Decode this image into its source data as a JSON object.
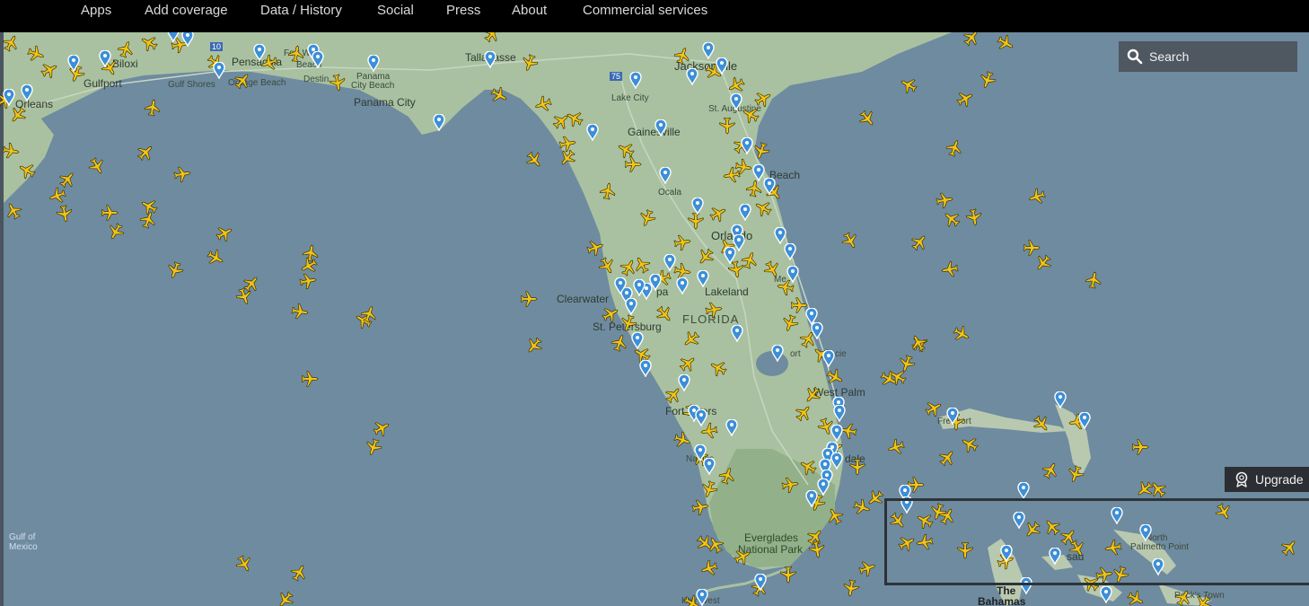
{
  "nav": {
    "items": [
      "Apps",
      "Add coverage",
      "Data / History",
      "Social",
      "Press",
      "About",
      "Commercial services"
    ]
  },
  "search": {
    "label": "Search",
    "icon": "search-icon"
  },
  "upgrade": {
    "label": "Upgrade",
    "icon": "award-icon"
  },
  "map_labels": {
    "biloxi": "Biloxi",
    "gulfport": "Gulfport",
    "orleans": "Orleans",
    "gulf_shores": "Gulf Shores",
    "orange_beach": "Orange Beach",
    "pensacola": "Pensacola",
    "fort_walton": "Fort W",
    "fort_walton_2": "Beach",
    "destin": "Destin",
    "panama_city_beach_1": "Panama",
    "panama_city_beach_2": "City Beach",
    "panama_city": "Panama City",
    "tallahassee": "Tallahasse",
    "jacksonville": "Jacksonville",
    "lake_city": "Lake City",
    "st_augustine": "St. Augustine",
    "gainesville": "Gainesville",
    "daytona": "Beach",
    "ocala": "Ocala",
    "orlando": "Orlando",
    "clearwater": "Clearwater",
    "tampa": "pa",
    "lakeland": "Lakeland",
    "florida": "FLORIDA",
    "st_petersburg": "St. Petersburg",
    "melbourne": "Me",
    "fort_pierce": "ort",
    "lucie": "cie",
    "west_palm": "West Palm",
    "fort_myers": "Fort Myers",
    "naples": "Naples",
    "dale": "dale",
    "everglades": "Everglades",
    "national_park": "National Park",
    "freeport": "Freeport",
    "nassau": "sau",
    "north": "North",
    "palmetto_point": "Palmetto Point",
    "the_bahamas_1": "The",
    "the_bahamas_2": "Bahamas",
    "rocks_town": "Rock's Town",
    "key_west": "Key West",
    "gulf_of_mexico_1": "Gulf of",
    "gulf_of_mexico_2": "Mexico",
    "hwy_10": "10",
    "hwy_75": "75"
  },
  "colors": {
    "water": "#6f8ba0",
    "land": "#a9c1a0",
    "land_south": "#9ab692",
    "plane": "#f2c417",
    "plane_outline": "#3a3000",
    "pin": "#3c8fd8",
    "nav_bg": "#000000",
    "search_bg": "#4f5760"
  }
}
